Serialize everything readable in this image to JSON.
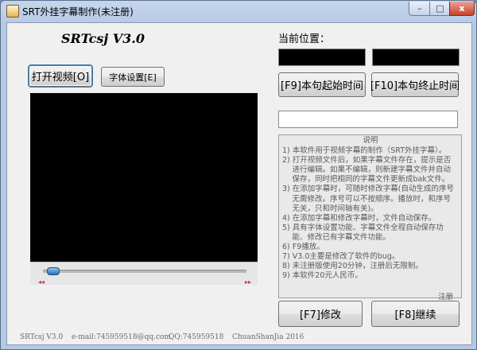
{
  "window": {
    "title": "SRT外挂字幕制作(未注册)",
    "controls": {
      "minimize": "–",
      "maximize": "□",
      "close": "x"
    }
  },
  "app": {
    "title": "SRTcsj V3.0"
  },
  "buttons": {
    "open_video": "打开视频[O]",
    "font_settings": "字体设置[E]",
    "start_time": "[F9]本句起始时间",
    "end_time": "[F10]本句终止时间",
    "modify": "[F7]修改",
    "continue": "[F8]继续"
  },
  "position": {
    "label": "当前位置：",
    "start_value": "",
    "end_value": ""
  },
  "subtitle_input": {
    "value": ""
  },
  "instructions": {
    "title": "说明",
    "lines": [
      "1) 本软件用于视频字幕的制作（SRT外挂字幕）。",
      "2) 打开视频文件后，如果字幕文件存在，提示是否",
      "　 进行编辑。如果不编辑，则新建字幕文件并自动",
      "　 保存，同时把相同的字幕文件更新成bak文件。",
      "3) 在添加字幕时，可随时修改字幕(自动生成的序号",
      "　 无需修改。序号可以不按顺序。播放时，和序号",
      "　 无关，只和时间轴有关)。",
      "4) 在添加字幕和修改字幕时，文件自动保存。",
      "5) 具有字体设置功能、字幕文件全程自动保存功",
      "　 能、修改已有字幕文件功能。",
      "6) F9播放。",
      "7) V3.0主要是修改了软件的bug。",
      "8) 未注册版使用20分钟，注册后无限制。",
      "9) 本软件20元人民币。"
    ]
  },
  "register": {
    "label": "注册"
  },
  "footer": {
    "version": "SRTcsj V3.0",
    "email": "e-mail:745959518@qq.com",
    "qq": "QQ:745959518",
    "author": "ChuanShanJia 2016"
  },
  "player": {
    "progress": 0.02
  },
  "colors": {
    "accent": "#3c7fb1",
    "video_bg": "#000000",
    "close_button": "#c7402b"
  }
}
